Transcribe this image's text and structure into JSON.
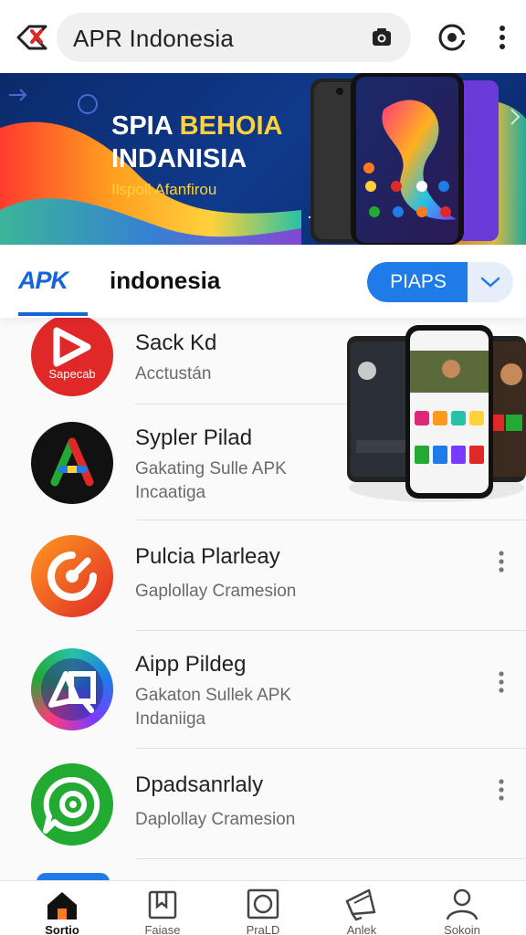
{
  "search": {
    "query": "APR Indonesia"
  },
  "banner": {
    "headline_white": "SPIA ",
    "headline_yellow": "BEHOIA",
    "headline_line2": "INDANISIA",
    "subtitle": "Ilspoll Afanfirou"
  },
  "section": {
    "logo": "APK",
    "title": "indonesia",
    "button_label": "PIAPS"
  },
  "apps": [
    {
      "name": "Sack Kd",
      "sub": [
        "Acctustán"
      ],
      "icon_text": "Sapecab",
      "icon_color": "#e02828"
    },
    {
      "name": "Sypler Pilad",
      "sub": [
        "Gakating Sulle APK",
        "Incaatiga"
      ],
      "icon_color": "#111111"
    },
    {
      "name": "Pulcia Plarleay",
      "sub": [
        "Gaplollay Cramesion"
      ],
      "icon_color": "#f2501e"
    },
    {
      "name": "Aipp Pildeg",
      "sub": [
        "Gakaton Sullek APK",
        "Indaniiga"
      ],
      "icon_color": "#3a49c9"
    },
    {
      "name": "Dpadsanrlaly",
      "sub": [
        "Daplollay Cramesion"
      ],
      "icon_color": "#22aa33"
    }
  ],
  "nav": [
    {
      "label": "Sortio",
      "icon": "home-icon",
      "active": true
    },
    {
      "label": "Faiase",
      "icon": "bookmark-icon"
    },
    {
      "label": "PraLD",
      "icon": "square-icon"
    },
    {
      "label": "Anlek",
      "icon": "megaphone-icon"
    },
    {
      "label": "Sokoin",
      "icon": "user-icon"
    }
  ],
  "colors": {
    "accent": "#1e7be8",
    "banner_bg": "#103a8c",
    "brand_red": "#e02828"
  }
}
